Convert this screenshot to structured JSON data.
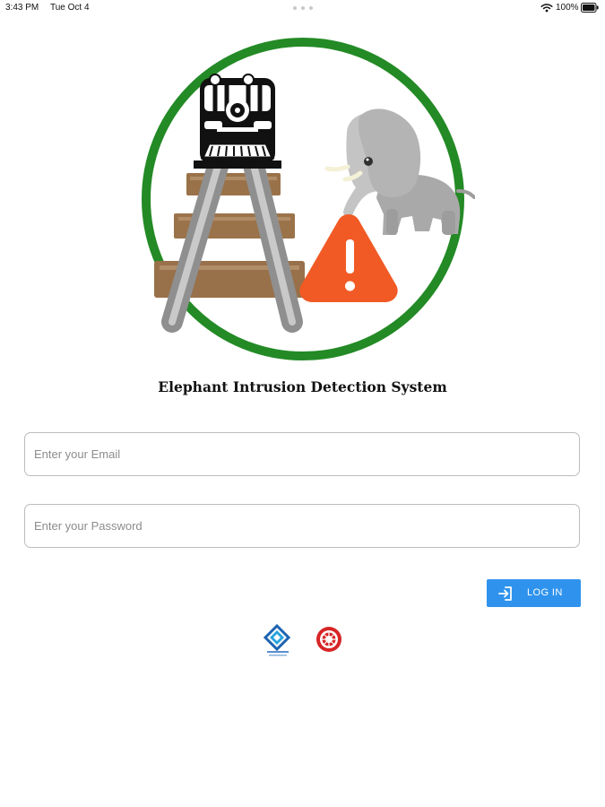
{
  "status_bar": {
    "time": "3:43 PM",
    "date": "Tue Oct 4",
    "battery_percent": "100%",
    "wifi_icon": "wifi-icon",
    "battery_icon": "battery-icon"
  },
  "hero": {
    "icon": "elephant-train-track-warning-illustration"
  },
  "app": {
    "title": "Elephant Intrusion Detection System"
  },
  "login_form": {
    "email_placeholder": "Enter your Email",
    "password_placeholder": "Enter your Password",
    "email_value": "",
    "password_value": "",
    "login_label": "LOG IN",
    "login_icon": "login-icon"
  },
  "partners": [
    {
      "name": "partner-logo-blue",
      "icon": "blue-diamond-logo-icon"
    },
    {
      "name": "partner-logo-red",
      "icon": "red-railway-seal-icon"
    }
  ],
  "colors": {
    "circle_green": "#238a25",
    "warning_orange": "#f15a25",
    "button_blue": "#2f93ed",
    "field_border": "#bcbcbc",
    "title_text": "#121212"
  }
}
